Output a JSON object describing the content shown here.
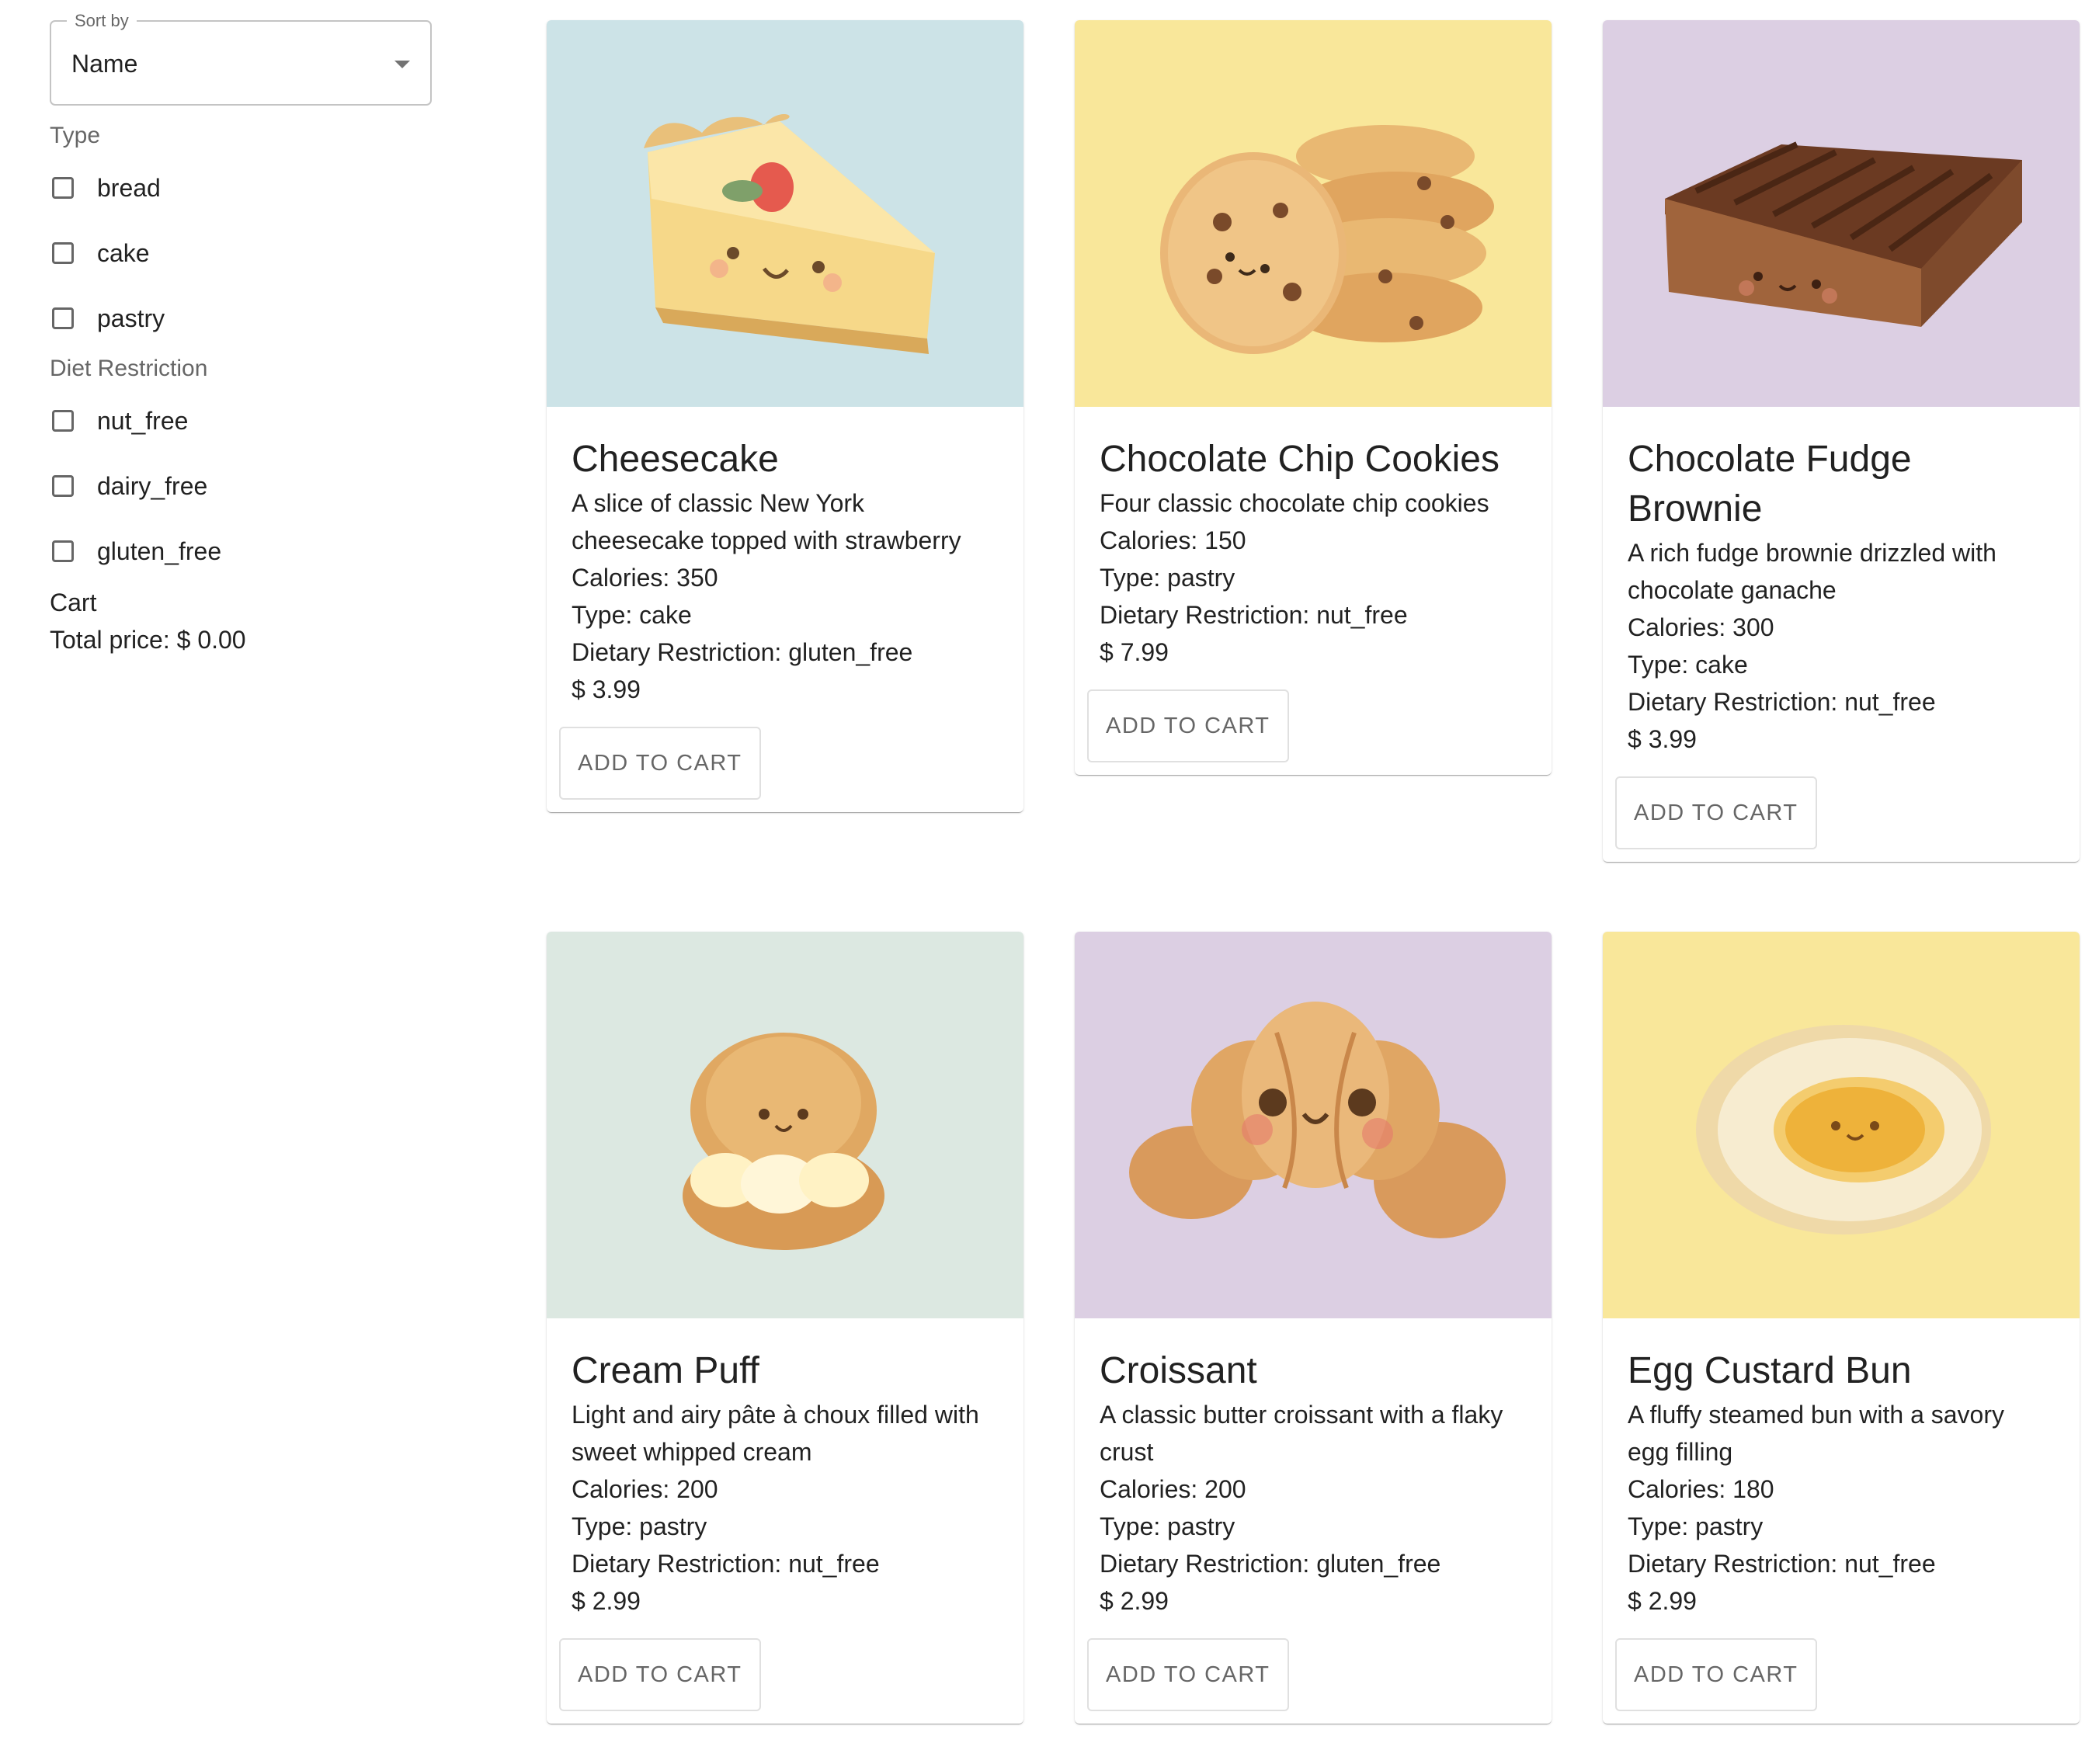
{
  "sort": {
    "label": "Sort by",
    "value": "Name"
  },
  "filters": {
    "type_title": "Type",
    "type_options": [
      "bread",
      "cake",
      "pastry"
    ],
    "diet_title": "Diet Restriction",
    "diet_options": [
      "nut_free",
      "dairy_free",
      "gluten_free"
    ]
  },
  "cart": {
    "title": "Cart",
    "total_label": "Total price:",
    "total_value": "$ 0.00"
  },
  "products": [
    {
      "name": "Cheesecake",
      "lines": [
        "A slice of classic New York",
        "cheesecake topped with strawberry"
      ],
      "calories": "Calories: 350",
      "type": "Type: cake",
      "diet": "Dietary Restriction: gluten_free",
      "price": "$ 3.99",
      "button": "ADD TO CART",
      "bg": "#cce3e7",
      "illustration": "cheesecake-illustration"
    },
    {
      "name": "Chocolate Chip Cookies",
      "lines": [
        "Four classic chocolate chip cookies"
      ],
      "calories": "Calories: 150",
      "type": "Type: pastry",
      "diet": "Dietary Restriction: nut_free",
      "price": "$ 7.99",
      "button": "ADD TO CART",
      "bg": "#f9e79a",
      "illustration": "cookies-illustration"
    },
    {
      "name": "Chocolate Fudge Brownie",
      "lines": [
        "A rich fudge brownie drizzled with",
        "chocolate ganache"
      ],
      "calories": "Calories: 300",
      "type": "Type: cake",
      "diet": "Dietary Restriction: nut_free",
      "price": "$ 3.99",
      "button": "ADD TO CART",
      "bg": "#dccfe3",
      "illustration": "brownie-illustration"
    },
    {
      "name": "Cream Puff",
      "lines": [
        "Light and airy pâte à choux filled with",
        "sweet whipped cream"
      ],
      "calories": "Calories: 200",
      "type": "Type: pastry",
      "diet": "Dietary Restriction: nut_free",
      "price": "$ 2.99",
      "button": "ADD TO CART",
      "bg": "#dce8e1",
      "illustration": "cream-puff-illustration"
    },
    {
      "name": "Croissant",
      "lines": [
        "A classic butter croissant with a flaky",
        "crust"
      ],
      "calories": "Calories: 200",
      "type": "Type: pastry",
      "diet": "Dietary Restriction: gluten_free",
      "price": "$ 2.99",
      "button": "ADD TO CART",
      "bg": "#dccfe3",
      "illustration": "croissant-illustration"
    },
    {
      "name": "Egg Custard Bun",
      "lines": [
        "A fluffy steamed bun with a savory",
        "egg filling"
      ],
      "calories": "Calories: 180",
      "type": "Type: pastry",
      "diet": "Dietary Restriction: nut_free",
      "price": "$ 2.99",
      "button": "ADD TO CART",
      "bg": "#f9e79a",
      "illustration": "egg-custard-bun-illustration"
    }
  ]
}
